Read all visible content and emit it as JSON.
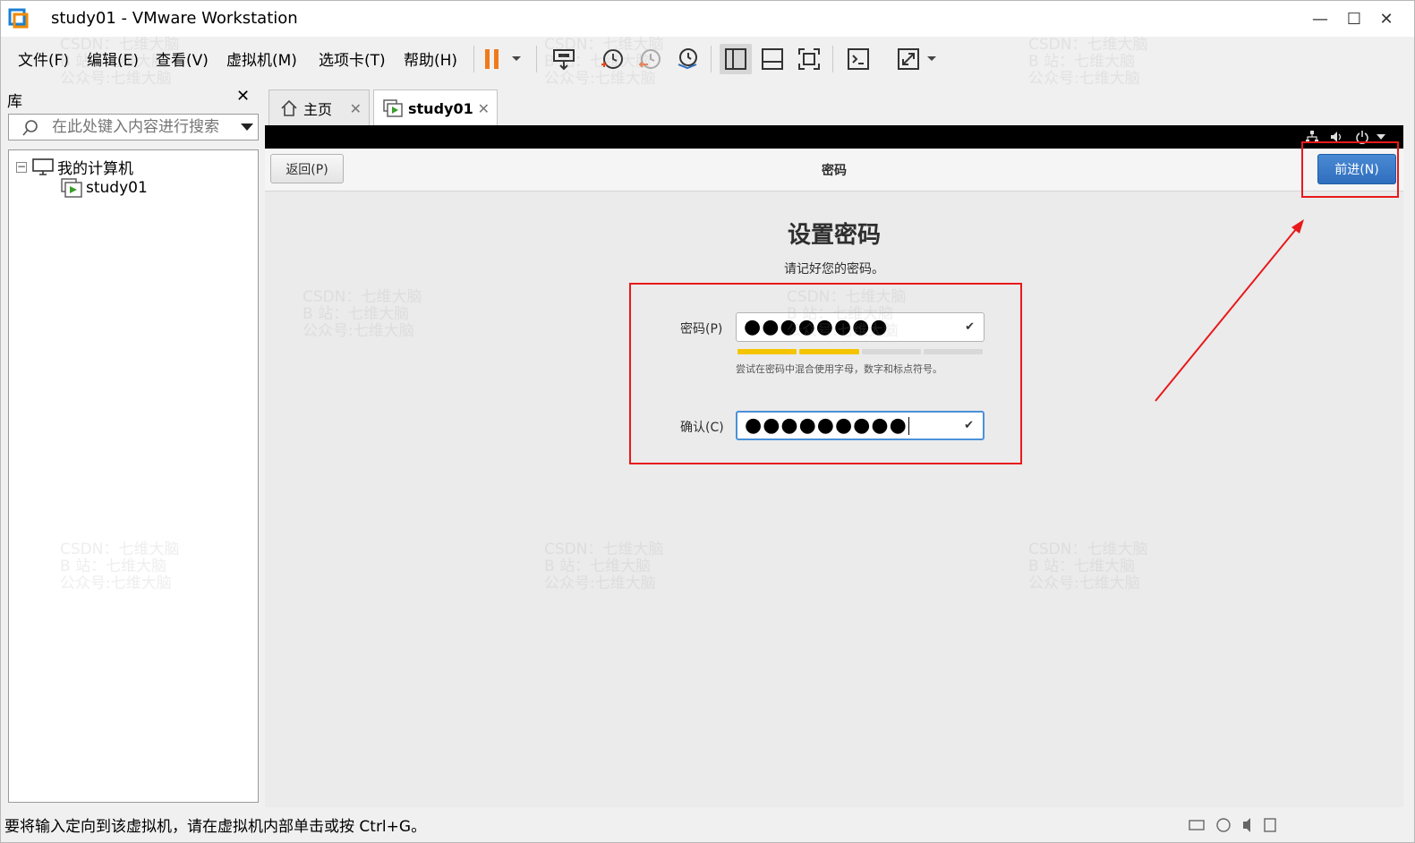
{
  "window": {
    "title": "study01 - VMware Workstation",
    "minimize": "—",
    "maximize": "☐",
    "close": "✕"
  },
  "menu": [
    "文件(F)",
    "编辑(E)",
    "查看(V)",
    "虚拟机(M)",
    "选项卡(T)",
    "帮助(H)"
  ],
  "library": {
    "title": "库",
    "close": "✕",
    "search_placeholder": "在此处键入内容进行搜索",
    "tree_root": "我的计算机",
    "tree_child": "study01",
    "expander": "−"
  },
  "tabs": [
    {
      "label": "主页",
      "close": "✕"
    },
    {
      "label": "study01",
      "close": "✕"
    }
  ],
  "guest": {
    "back_label": "返回(P)",
    "header_title": "密码",
    "next_label": "前进(N)",
    "heading": "设置密码",
    "subtitle": "请记好您的密码。",
    "password_label": "密码(P)",
    "password_value": "●●●●●●●●",
    "strength_hint": "尝试在密码中混合使用字母，数字和标点符号。",
    "confirm_label": "确认(C)",
    "confirm_value": "●●●●●●●●●",
    "check": "✔",
    "strength_level": 0.5
  },
  "status": {
    "text": "要将输入定向到该虚拟机，请在虚拟机内部单击或按 Ctrl+G。"
  },
  "watermark": {
    "line1": "CSDN：七维大脑",
    "line2": "B 站：七维大脑",
    "line3": "公众号:七维大脑"
  },
  "colors": {
    "accent": "#2e6ebd",
    "annotation_red": "#e8191b",
    "strength_fill": "#f5c400"
  }
}
